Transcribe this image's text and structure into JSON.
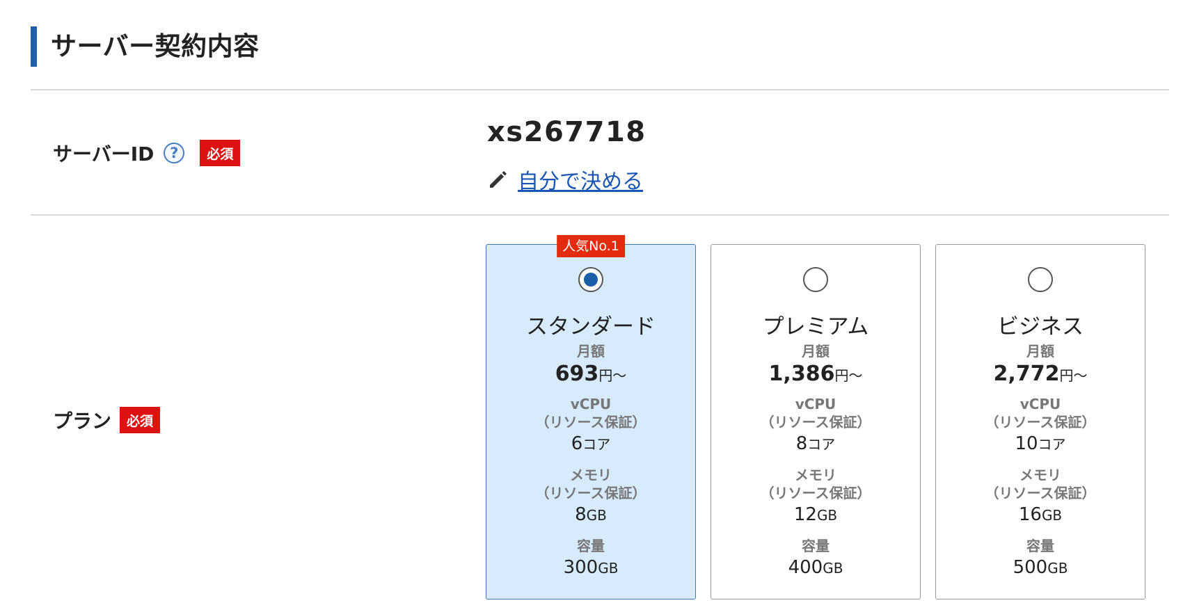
{
  "section": {
    "title": "サーバー契約内容"
  },
  "server_id": {
    "label": "サーバーID",
    "help": "?",
    "required": "必須",
    "value": "xs267718",
    "custom_link": "自分で決める"
  },
  "plan": {
    "label": "プラン",
    "required": "必須",
    "labels": {
      "monthly": "月額",
      "vcpu": "vCPU",
      "memory": "メモリ",
      "guarantee": "（リソース保証）",
      "storage": "容量"
    },
    "options": [
      {
        "name": "スタンダード",
        "badge": "人気No.1",
        "selected": true,
        "price": "693",
        "price_unit": "円〜",
        "vcpu": "6",
        "vcpu_unit": "コア",
        "memory": "8",
        "memory_unit": "GB",
        "storage": "300",
        "storage_unit": "GB"
      },
      {
        "name": "プレミアム",
        "selected": false,
        "price": "1,386",
        "price_unit": "円〜",
        "vcpu": "8",
        "vcpu_unit": "コア",
        "memory": "12",
        "memory_unit": "GB",
        "storage": "400",
        "storage_unit": "GB"
      },
      {
        "name": "ビジネス",
        "selected": false,
        "price": "2,772",
        "price_unit": "円〜",
        "vcpu": "10",
        "vcpu_unit": "コア",
        "memory": "16",
        "memory_unit": "GB",
        "storage": "500",
        "storage_unit": "GB"
      }
    ]
  },
  "colors": {
    "accent": "#1f5faa",
    "required_badge": "#dd1111",
    "popular_badge": "#e52b0f",
    "selected_card_bg": "#d7ebfc",
    "link": "#1a56b4"
  },
  "icons": {
    "help": "question-circle-icon",
    "edit": "pencil-icon"
  }
}
